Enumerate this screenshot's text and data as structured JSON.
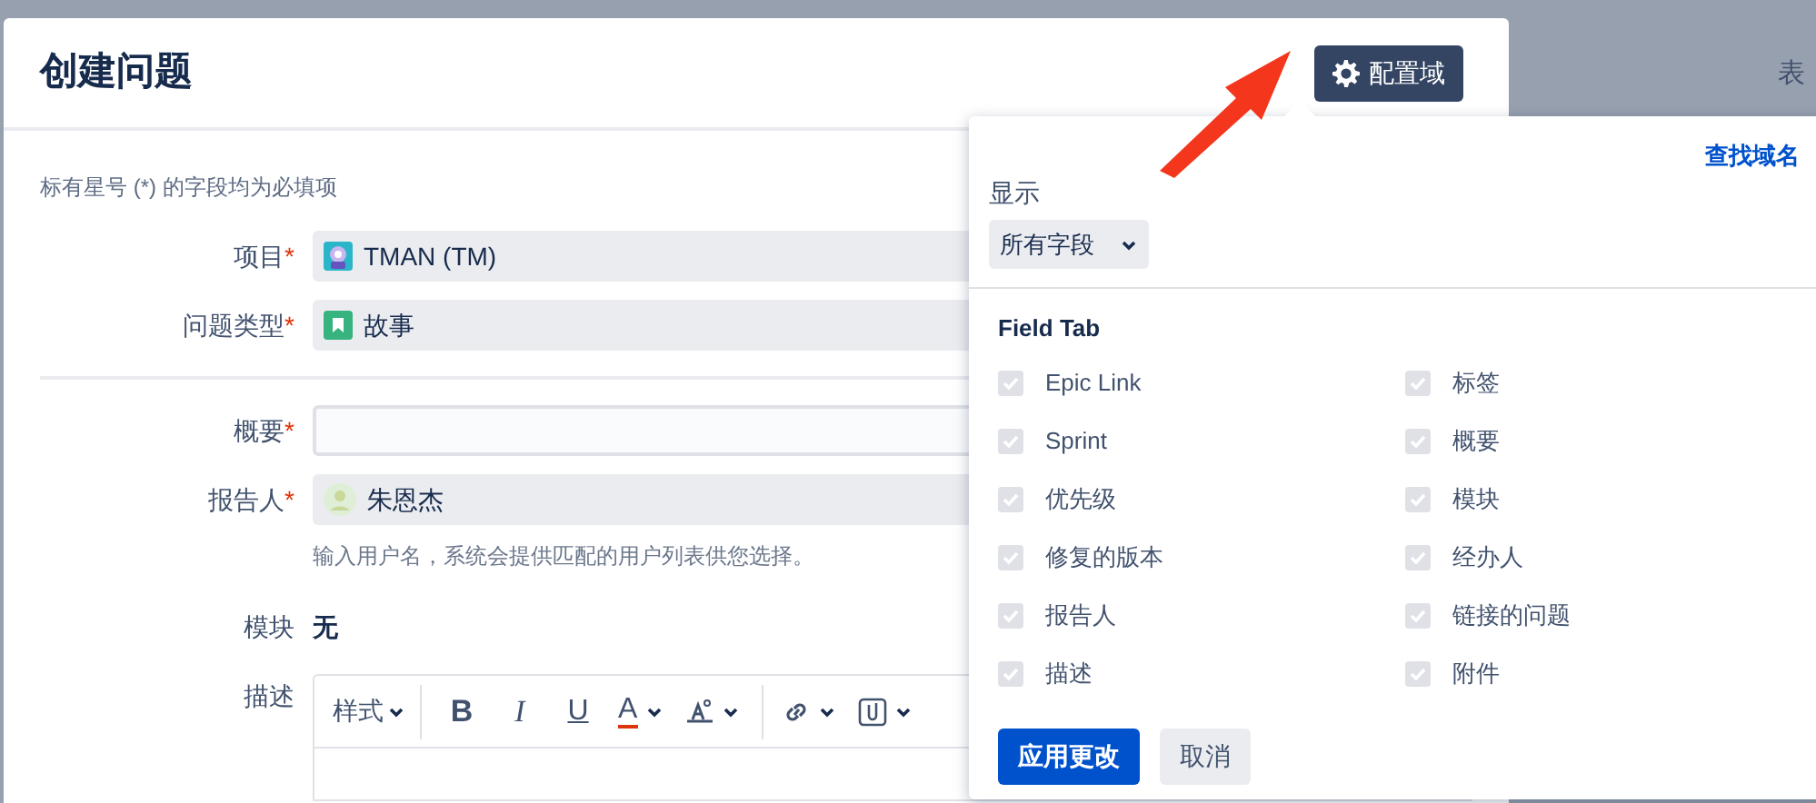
{
  "background": {
    "text": "表"
  },
  "dialog": {
    "title": "创建问题",
    "configure_button": "配置域",
    "required_note": "标有星号 (*) 的字段均为必填项",
    "fields": [
      {
        "kind": "project",
        "label": "项目",
        "mark": "*",
        "value": "TMAN (TM)"
      },
      {
        "kind": "issue-type",
        "label": "问题类型",
        "mark": "*",
        "value": "故事"
      },
      {
        "kind": "divider"
      },
      {
        "kind": "text",
        "label": "概要",
        "mark": "*"
      },
      {
        "kind": "user",
        "label": "报告人",
        "mark": "*",
        "value": "朱恩杰",
        "hint": "输入用户名，系统会提供匹配的用户列表供您选择。"
      },
      {
        "kind": "static",
        "label": "模块",
        "value": "无"
      },
      {
        "kind": "editor",
        "label": "描述",
        "toolbar": [
          {
            "kind": "menu",
            "label": "样式"
          },
          {
            "kind": "bold",
            "label": "B"
          },
          {
            "kind": "italic",
            "label": "I"
          },
          {
            "kind": "underline",
            "label": "U"
          },
          {
            "kind": "color",
            "label": "A"
          },
          {
            "kind": "format"
          },
          {
            "kind": "link"
          },
          {
            "kind": "attach"
          }
        ]
      }
    ]
  },
  "popup": {
    "find_link": "查找域名",
    "show_label": "显示",
    "show_select": "所有字段",
    "section": "Field Tab",
    "items": [
      {
        "label": "Epic Link",
        "checked": true,
        "disabled": true
      },
      {
        "label": "Sprint",
        "checked": true,
        "disabled": true
      },
      {
        "label": "优先级",
        "checked": true,
        "disabled": true
      },
      {
        "label": "修复的版本",
        "checked": true,
        "disabled": true
      },
      {
        "label": "报告人",
        "checked": true,
        "disabled": true
      },
      {
        "label": "描述",
        "checked": true,
        "disabled": true
      },
      {
        "label": "标签",
        "checked": true,
        "disabled": true
      },
      {
        "label": "概要",
        "checked": true,
        "disabled": true
      },
      {
        "label": "模块",
        "checked": true,
        "disabled": true
      },
      {
        "label": "经办人",
        "checked": true,
        "disabled": true
      },
      {
        "label": "链接的问题",
        "checked": true,
        "disabled": true
      },
      {
        "label": "附件",
        "checked": true,
        "disabled": true
      }
    ],
    "buttons": [
      {
        "kind": "primary",
        "label": "应用更改"
      },
      {
        "kind": "secondary",
        "label": "取消"
      }
    ]
  }
}
